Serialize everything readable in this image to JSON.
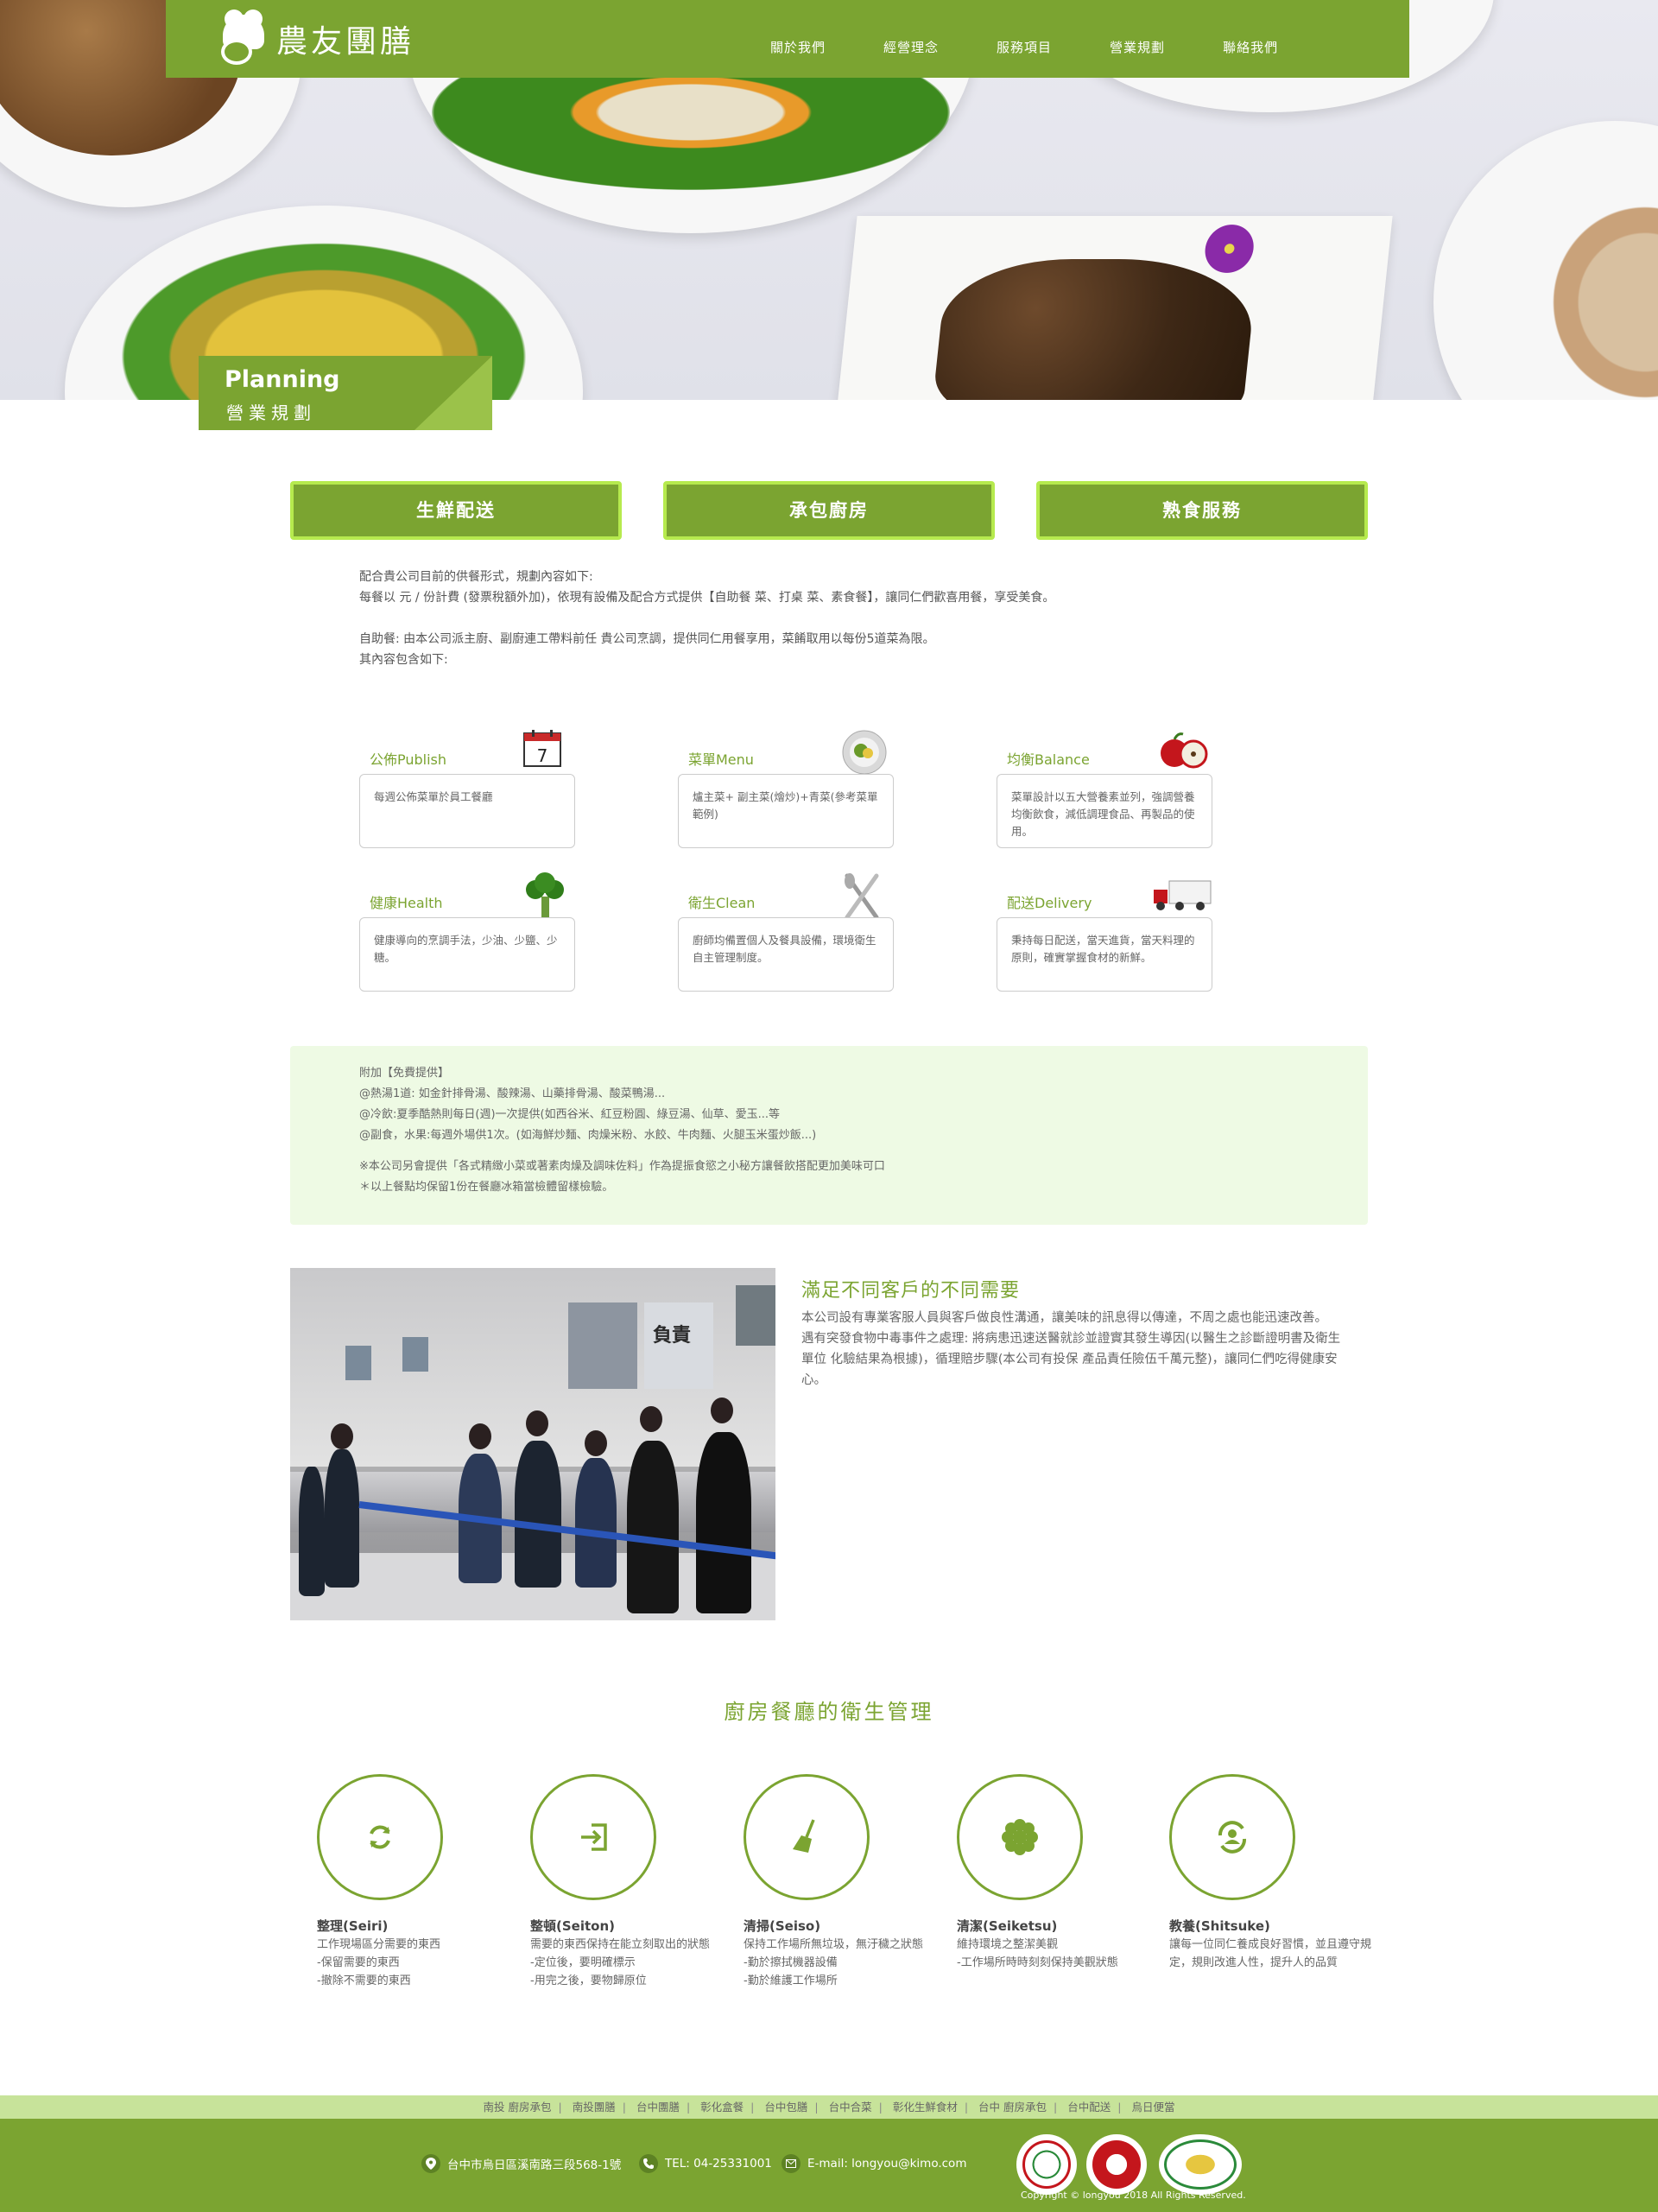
{
  "header": {
    "logo_text": "農友團膳",
    "nav": [
      "關於我們",
      "經營理念",
      "服務項目",
      "營業規劃",
      "聯絡我們"
    ]
  },
  "banner": {
    "title_en": "Planning",
    "title_zh": "營業規劃"
  },
  "tabs": [
    "生鮮配送",
    "承包廚房",
    "熟食服務"
  ],
  "intro": {
    "line1": "配合貴公司目前的供餐形式，規劃內容如下:",
    "line2": "每餐以 元 / 份計費 (發票稅額外加)，依現有設備及配合方式提供【自助餐 菜、打桌 菜、素食餐】，讓同仁們歡喜用餐，享受美食。",
    "line3": "自助餐: 由本公司派主廚、副廚連工帶料前任 貴公司烹調，提供同仁用餐享用，菜餚取用以每份5道菜為限。",
    "line4": "其內容包含如下:"
  },
  "features": [
    {
      "title": "公佈Publish",
      "icon": "calendar-icon",
      "calendar_day": "7",
      "text": "每週公佈菜單於員工餐廳"
    },
    {
      "title": "菜單Menu",
      "icon": "dish-icon",
      "text": "爐主菜+ 副主菜(燴炒)+青菜(參考菜單範例)"
    },
    {
      "title": "均衡Balance",
      "icon": "apple-icon",
      "text": "菜單設計以五大營養素並列，強調營養均衡飲食，減低調理食品、再製品的使用。"
    },
    {
      "title": "健康Health",
      "icon": "broccoli-icon",
      "text": "健康導向的烹調手法，少油、少鹽、少糖。"
    },
    {
      "title": "衛生Clean",
      "icon": "utensils-icon",
      "text": "廚師均備置個人及餐具設備，環境衛生自主管理制度。"
    },
    {
      "title": "配送Delivery",
      "icon": "truck-icon",
      "text": "秉持每日配送，當天進貨，當天料理的原則，確實掌握食材的新鮮。"
    }
  ],
  "free": {
    "lines": [
      "附加【免費提供】",
      "@熱湯1道: 如金針排骨湯、酸辣湯、山藥排骨湯、酸菜鴨湯...",
      "@冷飲:夏季酷熱則每日(週)一次提供(如西谷米、紅豆粉圓、綠豆湯、仙草、愛玉...等",
      "@副食，水果:每週外場供1次。(如海鮮炒麵、肉燥米粉、水餃、牛肉麵、火腿玉米蛋炒飯...)"
    ],
    "notes": [
      "※本公司另會提供「各式精緻小菜或著素肉燥及調味佐料」作為提振食慾之小秘方讓餐飲搭配更加美味可口",
      "＊以上餐點均保留1份在餐廳冰箱當檢體留樣檢驗。"
    ]
  },
  "side": {
    "title": "滿足不同客戶的不同需要",
    "p1": "本公司設有專業客服人員與客戶做良性溝通，讓美味的訊息得以傳達，不周之處也能迅速改善。",
    "p2": "遇有突發食物中毒事件之處理: 將病患迅速送醫就診並證實其發生導因(以醫生之診斷證明書及衛生單位 化驗結果為根據)，循理賠步驟(本公司有投保 產品責任險伍千萬元整)，讓同仁們吃得健康安心。",
    "photo_poster_text": "負責"
  },
  "hygiene": {
    "title": "廚房餐廳的衛生管理",
    "items": [
      {
        "name": "整理(Seiri)",
        "icon": "refresh-icon",
        "lines": [
          "工作現場區分需要的東西",
          "-保留需要的東西",
          "-撤除不需要的東西"
        ]
      },
      {
        "name": "整頓(Seiton)",
        "icon": "sign-in-icon",
        "lines": [
          "需要的東西保持在能立刻取出的狀態",
          "-定位後，要明確標示",
          "-用完之後，要物歸原位"
        ]
      },
      {
        "name": "清掃(Seiso)",
        "icon": "broom-icon",
        "lines": [
          "保持工作場所無垃圾，無汙穢之狀態",
          "-勤於擦拭機器設備",
          "-勤於維護工作場所"
        ]
      },
      {
        "name": "清潔(Seiketsu)",
        "icon": "flower-icon",
        "lines": [
          "維持環境之整潔美觀",
          "-工作場所時時刻刻保持美觀狀態"
        ]
      },
      {
        "name": "教養(Shitsuke)",
        "icon": "user-refresh-icon",
        "lines": [
          "讓每一位同仁養成良好習慣，並且遵守規定，規則改進人性，提升人的品質"
        ]
      }
    ]
  },
  "footer": {
    "links": [
      "南投 廚房承包",
      "南投團膳",
      "台中團膳",
      "彰化盒餐",
      "台中包膳",
      "台中合菜",
      "彰化生鮮食材",
      "台中 廚房承包",
      "台中配送",
      "烏日便當"
    ],
    "address": "台中市烏日區溪南路三段568-1號",
    "tel": "TEL: 04-25331001",
    "email": "E-mail: longyou@kimo.com",
    "copyright": "Copyright © longyou 2018 All Rights Reserved.",
    "colors": {
      "brand": "#7ba431",
      "light": "#c7e39a"
    }
  }
}
